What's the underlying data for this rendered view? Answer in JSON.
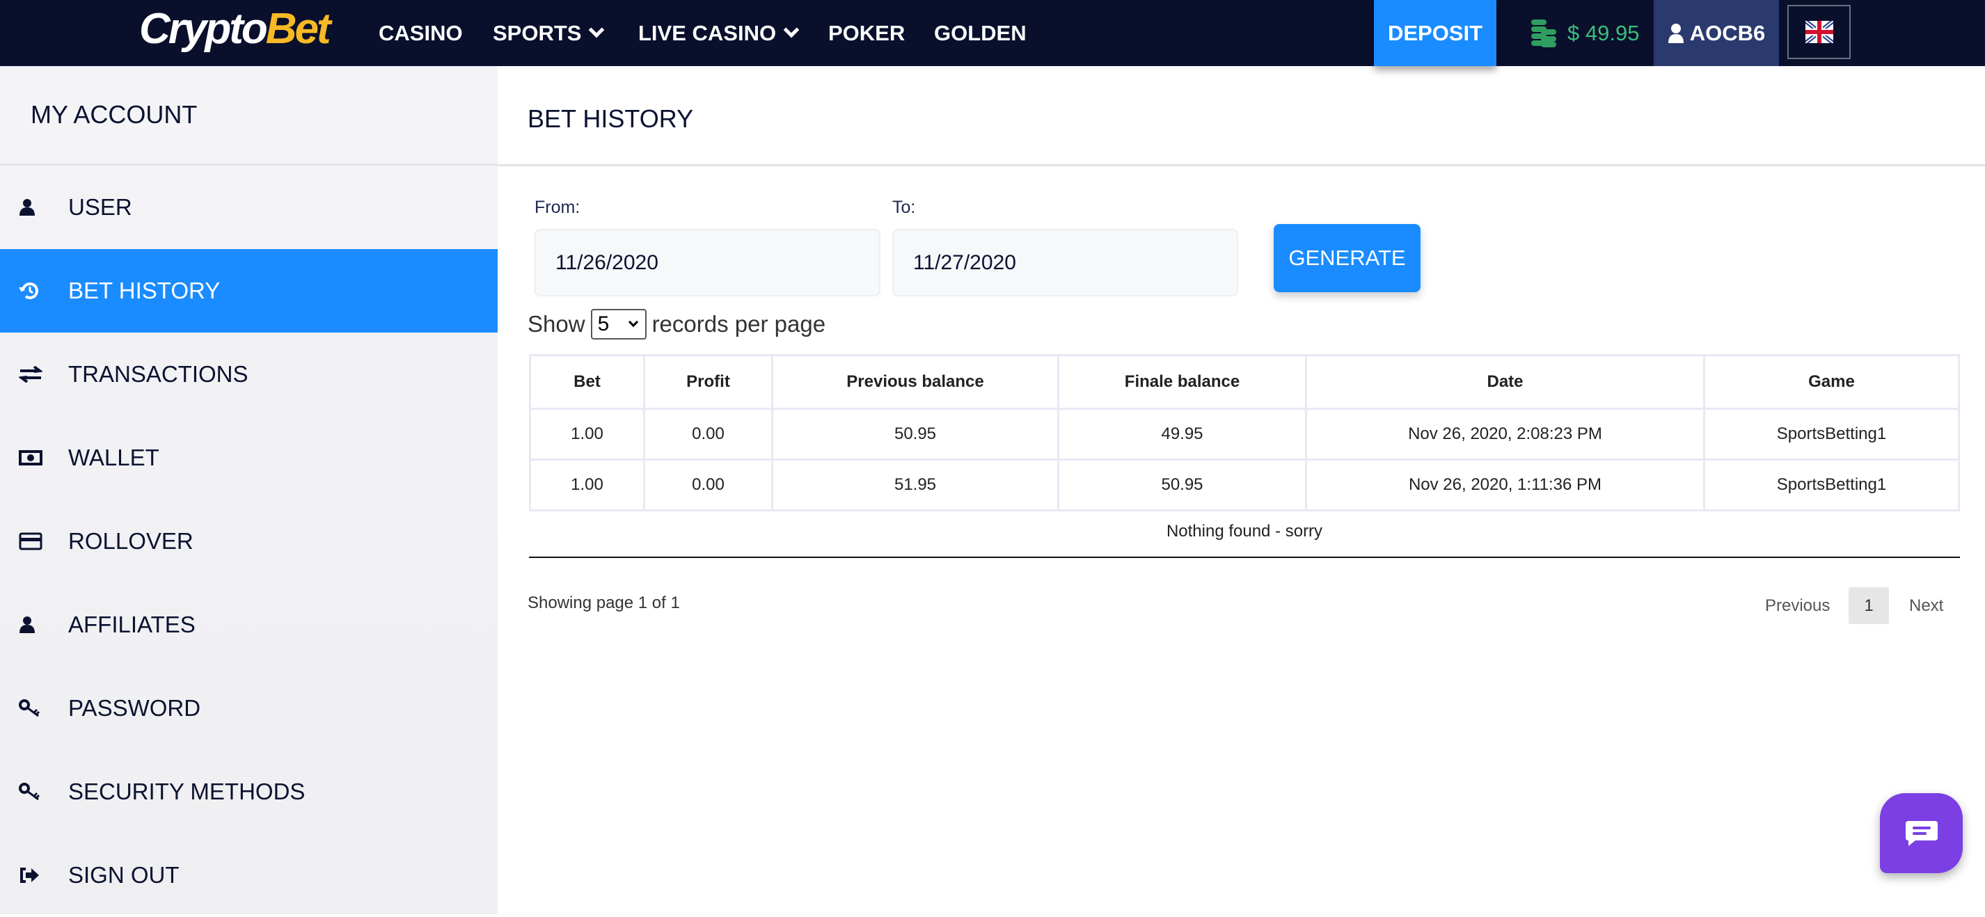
{
  "header": {
    "logo_part1": "Crypto",
    "logo_part2": "Bet",
    "nav": [
      "CASINO",
      "SPORTS",
      "LIVE CASINO",
      "POKER",
      "GOLDEN"
    ],
    "deposit": "DEPOSIT",
    "balance": "$ 49.95",
    "username": "AOCB6",
    "language": "en-GB"
  },
  "sidebar": {
    "title": "MY ACCOUNT",
    "items": [
      {
        "label": "USER",
        "icon": "user-icon"
      },
      {
        "label": "BET HISTORY",
        "icon": "history-icon",
        "active": true
      },
      {
        "label": "TRANSACTIONS",
        "icon": "exchange-icon"
      },
      {
        "label": "WALLET",
        "icon": "money-bill-icon"
      },
      {
        "label": "ROLLOVER",
        "icon": "credit-card-icon"
      },
      {
        "label": "AFFILIATES",
        "icon": "user-icon"
      },
      {
        "label": "PASSWORD",
        "icon": "key-icon"
      },
      {
        "label": "SECURITY METHODS",
        "icon": "key-icon"
      },
      {
        "label": "SIGN OUT",
        "icon": "sign-out-icon"
      }
    ]
  },
  "main": {
    "title": "BET HISTORY",
    "from_label": "From:",
    "from_value": "11/26/2020",
    "to_label": "To:",
    "to_value": "11/27/2020",
    "generate": "GENERATE",
    "show": "Show",
    "per_page": "5",
    "records_per_page": "records per page",
    "table": {
      "headers": [
        "Bet",
        "Profit",
        "Previous balance",
        "Finale balance",
        "Date",
        "Game"
      ],
      "rows": [
        [
          "1.00",
          "0.00",
          "50.95",
          "49.95",
          "Nov 26, 2020, 2:08:23 PM",
          "SportsBetting1"
        ],
        [
          "1.00",
          "0.00",
          "51.95",
          "50.95",
          "Nov 26, 2020, 1:11:36 PM",
          "SportsBetting1"
        ]
      ]
    },
    "nothing_found": "Nothing found - sorry",
    "showing": "Showing page 1 of 1",
    "prev": "Previous",
    "page": "1",
    "next": "Next"
  },
  "colors": {
    "header_bg": "#0a0f2c",
    "accent": "#1a8cff",
    "balance": "#3bbf7a",
    "user_bg": "#2b3a6e",
    "chat": "#7b3fe4",
    "logo_accent": "#f7b924"
  }
}
